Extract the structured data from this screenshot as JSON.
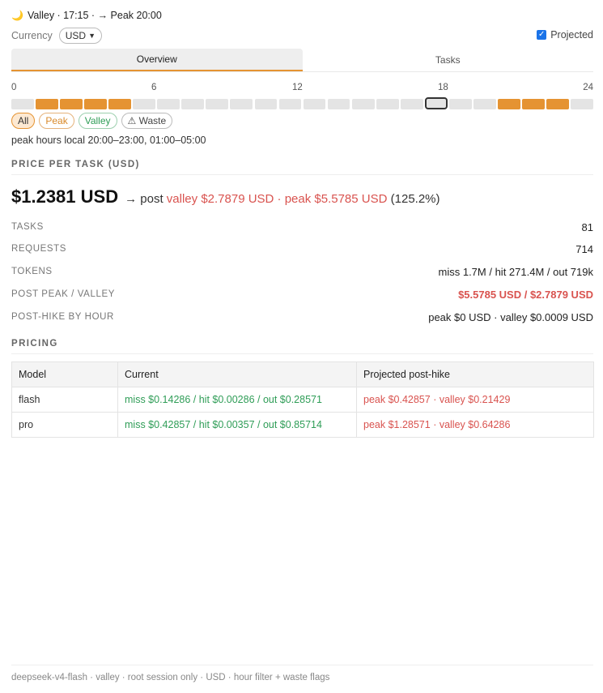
{
  "status": {
    "icon": "moon-icon",
    "text": "Valley · 17:15 · → Peak 20:00"
  },
  "currency": {
    "label": "Currency",
    "selected": "USD"
  },
  "projected": {
    "label": "Projected",
    "checked": true
  },
  "tabs": [
    {
      "label": "Overview",
      "active": true
    },
    {
      "label": "Tasks",
      "active": false
    }
  ],
  "timeline": {
    "ticks": [
      "0",
      "6",
      "12",
      "18",
      "24"
    ],
    "peak_hours": [
      1,
      2,
      3,
      4,
      20,
      21,
      22
    ],
    "current_hour": 17,
    "peak_color": "#e59332",
    "offpeak_color": "#e4e4e4"
  },
  "filters": [
    {
      "label": "All",
      "kind": "all"
    },
    {
      "label": "Peak",
      "kind": "peak"
    },
    {
      "label": "Valley",
      "kind": "valley"
    },
    {
      "label": "⚠ Waste",
      "kind": "waste"
    }
  ],
  "peak_hours_text": "peak hours local 20:00–23:00, 01:00–05:00",
  "price_section": {
    "title": "PRICE PER TASK (USD)",
    "current": "$1.2381 USD",
    "arrow_text": "→ post",
    "post_text": "valley $2.7879 USD · peak $5.5785 USD",
    "pct": "(125.2%)"
  },
  "metrics": [
    {
      "key": "TASKS",
      "value": "81",
      "red": false
    },
    {
      "key": "REQUESTS",
      "value": "714",
      "red": false
    },
    {
      "key": "TOKENS",
      "value": "miss 1.7M / hit 271.4M / out 719k",
      "red": false
    },
    {
      "key": "POST PEAK / VALLEY",
      "value": "$5.5785 USD / $2.7879 USD",
      "red": true
    },
    {
      "key": "POST-HIKE BY HOUR",
      "value": "peak $0 USD · valley $0.0009 USD",
      "red": false
    }
  ],
  "pricing": {
    "title": "PRICING",
    "headers": [
      "Model",
      "Current",
      "Projected post-hike"
    ],
    "rows": [
      {
        "model": "flash",
        "current": "miss $0.14286 / hit $0.00286 / out $0.28571",
        "projected": "peak $0.42857 · valley $0.21429"
      },
      {
        "model": "pro",
        "current": "miss $0.42857 / hit $0.00357 / out $0.85714",
        "projected": "peak $1.28571 · valley $0.64286"
      }
    ]
  },
  "footer": "deepseek-v4-flash · valley · root session only · USD · hour filter + waste flags"
}
